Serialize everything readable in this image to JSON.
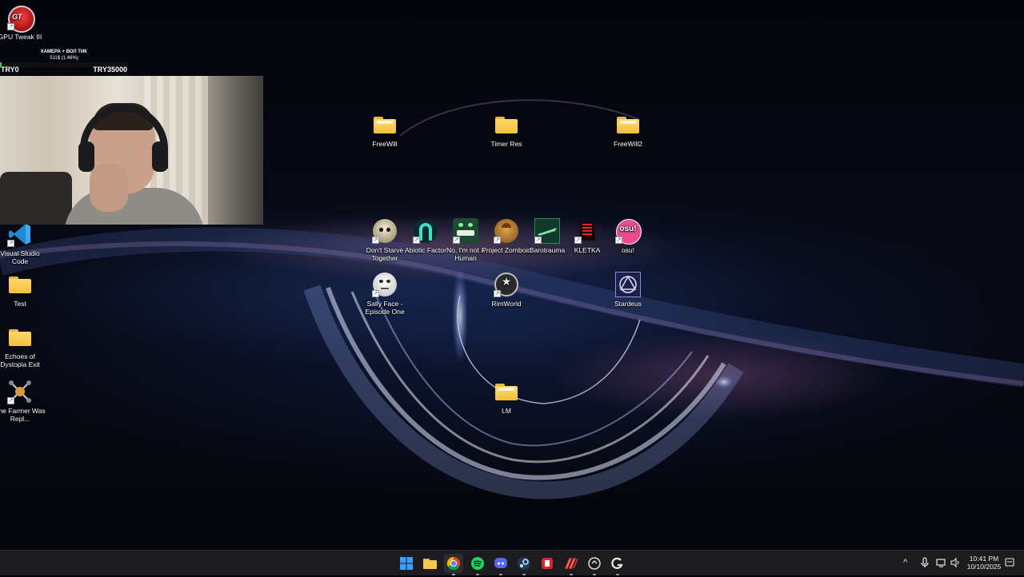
{
  "desktop": {
    "icons": [
      {
        "label": "GPU Tweak III",
        "icon": "gpu-tweak-icon"
      },
      {
        "label": "Visual Studio Code",
        "icon": "vscode-icon"
      },
      {
        "label": "Test",
        "icon": "folder-icon"
      },
      {
        "label": "Echoes of Dystopia Exit",
        "icon": "folder-icon"
      },
      {
        "label": "The Farmer Was Repl...",
        "icon": "farmer-drone-icon"
      },
      {
        "label": "FreeWill",
        "icon": "folder-icon"
      },
      {
        "label": "Timer Res",
        "icon": "folder-icon"
      },
      {
        "label": "FreeWill2",
        "icon": "folder-icon"
      },
      {
        "label": "Don't Starve Together",
        "icon": "dont-starve-icon"
      },
      {
        "label": "Abiotic Factor",
        "icon": "abiotic-factor-icon"
      },
      {
        "label": "No, I'm not a Human",
        "icon": "not-human-icon"
      },
      {
        "label": "Project Zomboid",
        "icon": "project-zomboid-icon"
      },
      {
        "label": "Barotrauma",
        "icon": "barotrauma-icon"
      },
      {
        "label": "KLETKA",
        "icon": "kletka-icon"
      },
      {
        "label": "osu!",
        "icon": "osu-icon"
      },
      {
        "label": "Sally Face - Episode One",
        "icon": "sally-face-icon"
      },
      {
        "label": "RimWorld",
        "icon": "rimworld-icon"
      },
      {
        "label": "Stardeus",
        "icon": "stardeus-icon"
      },
      {
        "label": "LM",
        "icon": "folder-icon"
      }
    ],
    "osu_glyph": "osu!"
  },
  "overlay": {
    "title": "КАМЕРА + ВОЛ ТИК",
    "progress_text": "511$ (1.46%)",
    "progress_fraction": 0.0146,
    "left_label": "TRY0",
    "right_label": "TRY35000",
    "fill_color": "#2fd04a"
  },
  "taskbar": {
    "apps": [
      {
        "name": "start",
        "icon": "windows-start-icon"
      },
      {
        "name": "file-explorer",
        "icon": "folder-icon"
      },
      {
        "name": "chrome",
        "icon": "chrome-icon"
      },
      {
        "name": "spotify",
        "icon": "spotify-icon"
      },
      {
        "name": "discord",
        "icon": "discord-icon"
      },
      {
        "name": "steam",
        "icon": "steam-icon"
      },
      {
        "name": "app-red",
        "icon": "red-app-icon"
      },
      {
        "name": "app-stripes",
        "icon": "stripes-app-icon"
      },
      {
        "name": "app-circle",
        "icon": "circle-app-icon"
      },
      {
        "name": "app-g",
        "icon": "g-app-icon"
      }
    ],
    "tray": {
      "chevron": "^",
      "time": "10:41 PM",
      "date": "10/10/2025"
    }
  },
  "colors": {
    "accent_blue": "#0a84ff",
    "taskbar_bg": "#1c1c1e",
    "folder_yellow": "#f3bf3f"
  }
}
